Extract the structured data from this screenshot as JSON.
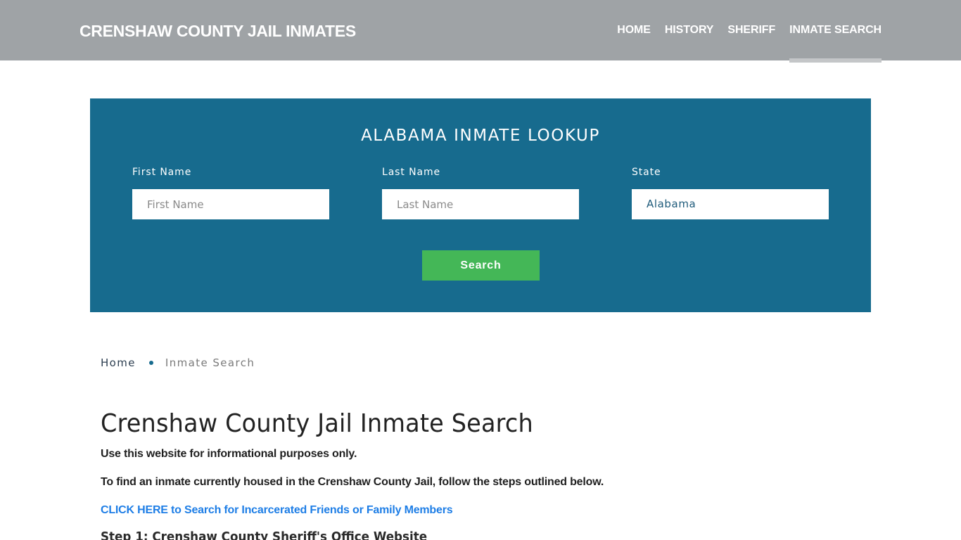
{
  "header": {
    "brand": "CRENSHAW COUNTY JAIL INMATES",
    "nav": [
      {
        "label": "HOME",
        "active": false
      },
      {
        "label": "HISTORY",
        "active": false
      },
      {
        "label": "SHERIFF",
        "active": false
      },
      {
        "label": "INMATE SEARCH",
        "active": true
      }
    ]
  },
  "lookup": {
    "title": "ALABAMA INMATE LOOKUP",
    "first_name": {
      "label": "First Name",
      "placeholder": "First Name",
      "value": ""
    },
    "last_name": {
      "label": "Last Name",
      "placeholder": "Last Name",
      "value": ""
    },
    "state": {
      "label": "State",
      "value": "Alabama"
    },
    "search_label": "Search",
    "colors": {
      "panel": "#176b8e",
      "button": "#44b757"
    }
  },
  "breadcrumb": {
    "home": "Home",
    "current": "Inmate Search"
  },
  "content": {
    "title": "Crenshaw County Jail Inmate Search",
    "paragraphs": [
      "Use this website for informational purposes only.",
      "To find an inmate currently housed in the Crenshaw County Jail, follow the steps outlined below."
    ],
    "cta_link": "CLICK HERE to Search for Incarcerated Friends or Family Members",
    "step1": "Step 1: Crenshaw County Sheriff's Office Website"
  }
}
